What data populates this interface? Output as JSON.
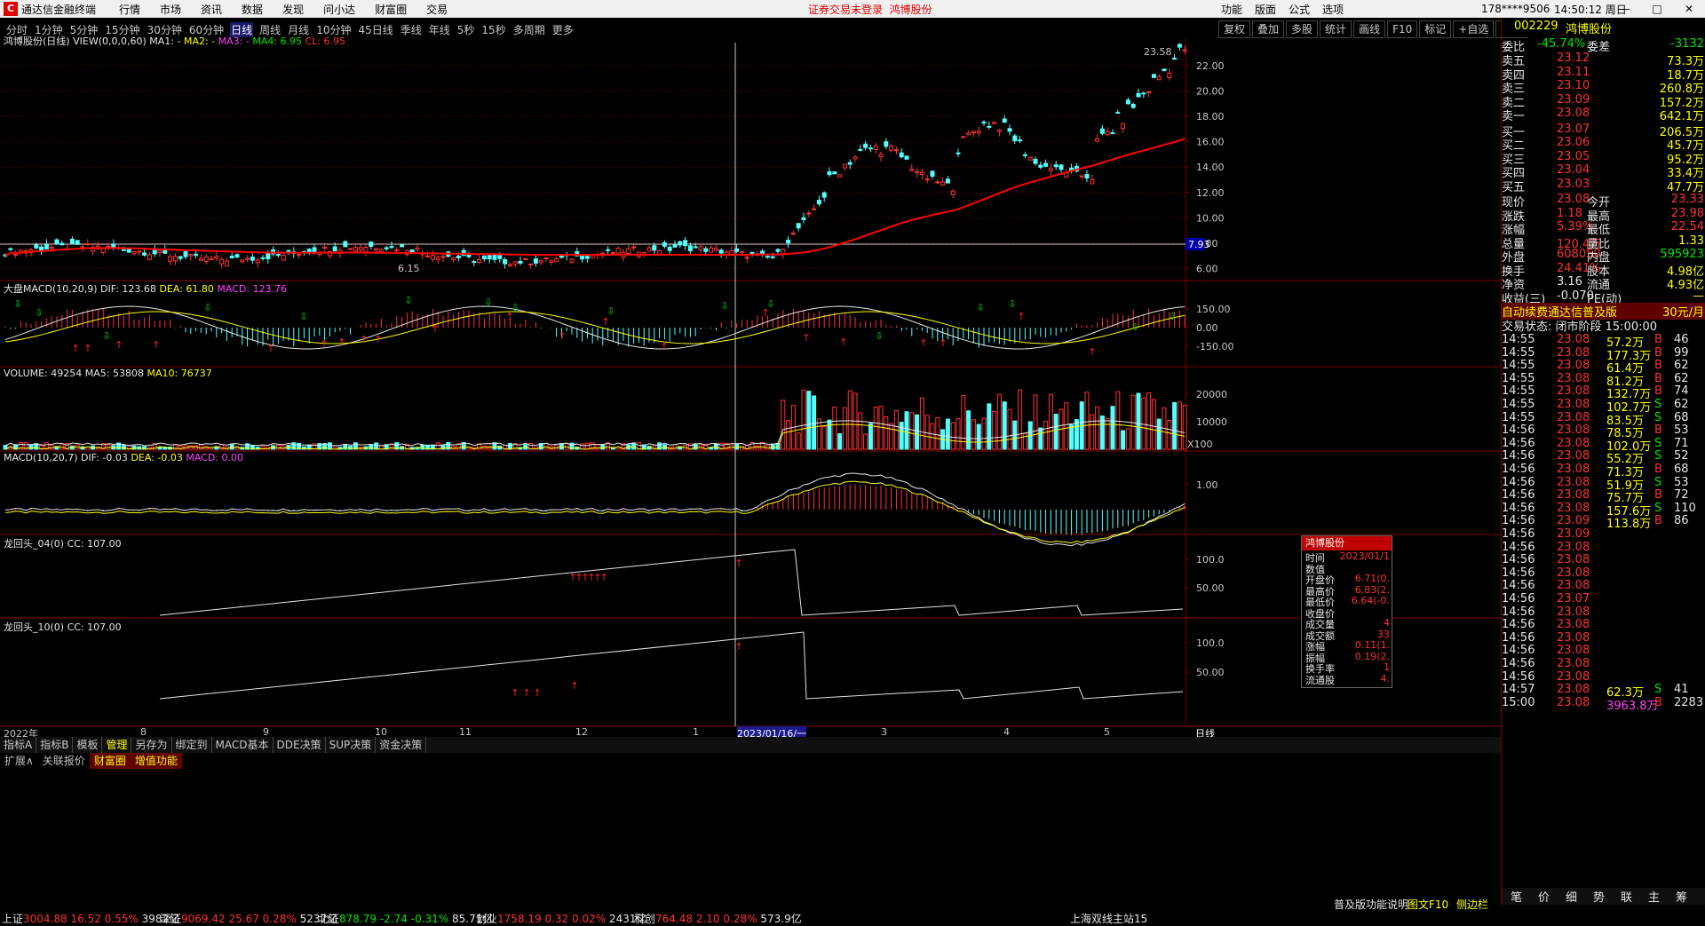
{
  "titlebar": {
    "app_name": "通达信金融终端",
    "menus": [
      "行情",
      "市场",
      "资讯",
      "数据",
      "发现",
      "问小达",
      "财富圈",
      "交易"
    ],
    "notice": "证券交易未登录",
    "stock": "鸿博股份",
    "right_menus": [
      "功能",
      "版面",
      "公式",
      "选项"
    ],
    "account": "178****9506",
    "time": "14:50:12 周日"
  },
  "periods": [
    "分时",
    "1分钟",
    "5分钟",
    "15分钟",
    "30分钟",
    "60分钟",
    "日线",
    "周线",
    "月线",
    "10分钟",
    "45日线",
    "季线",
    "年线",
    "5秒",
    "15秒",
    "多周期",
    "更多"
  ],
  "active_period": "日线",
  "toolbar_buttons": [
    "复权",
    "叠加",
    "多股",
    "统计",
    "画线",
    "F10",
    "标记",
    "+自选",
    "返回"
  ],
  "main_panel": {
    "title": "鸿博股份(日线)",
    "indicator": "VIEW(0,0,0,60)",
    "ma1": "MA1: -",
    "ma2": "MA2: -",
    "ma3": "MA3: -",
    "ma4": "MA4: 6.95",
    "cl": "CL: 6.95",
    "y_labels": [
      "22.00",
      "20.00",
      "18.00",
      "16.00",
      "14.00",
      "12.00",
      "10.00",
      "8.00",
      "6.00"
    ],
    "current_label": "7.93",
    "high_label": "23.58",
    "low_label": "6.15"
  },
  "macd1": {
    "title": "大盘MACD(10,20,9)",
    "dif": "DIF: 123.68",
    "dea": "DEA: 61.80",
    "macd": "MACD: 123.76",
    "y_labels": [
      "150.00",
      "0.00",
      "-150.00"
    ]
  },
  "volume": {
    "title": "VOLUME: 49254",
    "ma5": "MA5: 53808",
    "ma10": "MA10: 76737",
    "y_labels": [
      "20000",
      "10000"
    ],
    "unit": "X100"
  },
  "macd2": {
    "title": "MACD(10,20,7)",
    "dif": "DIF: -0.03",
    "dea": "DEA: -0.03",
    "macd": "MACD: 0.00",
    "y_labels": [
      "1.00"
    ]
  },
  "dragon1": {
    "title": "龙回头_04(0)",
    "cc": "CC: 107.00",
    "y_labels": [
      "100.0",
      "50.00"
    ]
  },
  "dragon2": {
    "title": "龙回头_10(0)",
    "cc": "CC: 107.00",
    "y_labels": [
      "100.0",
      "50.00"
    ]
  },
  "x_axis": {
    "labels": [
      "2022年",
      "8",
      "9",
      "10",
      "11",
      "12",
      "1",
      "2023/01/16/一",
      "3",
      "4",
      "5"
    ],
    "period": "日线"
  },
  "bottom_tabs": [
    "指标A",
    "指标B",
    "模板",
    "管理",
    "另存为",
    "绑定到",
    "MACD基本",
    "DDE决策",
    "SUP决策",
    "资金决策"
  ],
  "ext_bar": [
    "扩展∧",
    "关联报价",
    "财富圈",
    "增值功能"
  ],
  "quote": {
    "code": "002229",
    "name": "鸿博股份",
    "weibi_label": "委比",
    "weibi": "-45.74%",
    "weicha_label": "委差",
    "weicha": "-3132",
    "asks": [
      {
        "label": "卖五",
        "price": "23.12",
        "vol": "73.3万"
      },
      {
        "label": "卖四",
        "price": "23.11",
        "vol": "18.7万"
      },
      {
        "label": "卖三",
        "price": "23.10",
        "vol": "260.8万"
      },
      {
        "label": "卖二",
        "price": "23.09",
        "vol": "157.2万"
      },
      {
        "label": "卖一",
        "price": "23.08",
        "vol": "642.1万"
      }
    ],
    "bids": [
      {
        "label": "买一",
        "price": "23.07",
        "vol": "206.5万"
      },
      {
        "label": "买二",
        "price": "23.06",
        "vol": "45.7万"
      },
      {
        "label": "买三",
        "price": "23.05",
        "vol": "95.2万"
      },
      {
        "label": "买四",
        "price": "23.04",
        "vol": "33.4万"
      },
      {
        "label": "买五",
        "price": "23.03",
        "vol": "47.7万"
      }
    ],
    "stats": [
      {
        "l1": "现价",
        "v1": "23.08",
        "l2": "今开",
        "v2": "23.33"
      },
      {
        "l1": "涨跌",
        "v1": "1.18",
        "l2": "最高",
        "v2": "23.98"
      },
      {
        "l1": "涨幅",
        "v1": "5.39%",
        "l2": "最低",
        "v2": "22.54"
      },
      {
        "l1": "总量",
        "v1": "120.4万",
        "l2": "量比",
        "v2": "1.33"
      },
      {
        "l1": "外盘",
        "v1": "608050",
        "l2": "内盘",
        "v2": "595923"
      },
      {
        "l1": "换手",
        "v1": "24.41%",
        "l2": "股本",
        "v2": "4.98亿"
      },
      {
        "l1": "净资",
        "v1": "3.16",
        "l2": "流通",
        "v2": "4.93亿"
      },
      {
        "l1": "收益(三)",
        "v1": "-0.070",
        "l2": "PE(动)",
        "v2": "—"
      }
    ],
    "ad_text": "自动续费通达信普及版",
    "ad_price": "30元/月",
    "trade_status": "交易状态: 闭市阶段 15:00:00",
    "ticks": [
      {
        "t": "14:55",
        "p": "23.08",
        "v": "57.2万",
        "d": "B",
        "n": "46"
      },
      {
        "t": "14:55",
        "p": "23.08",
        "v": "177.3万",
        "d": "B",
        "n": "99"
      },
      {
        "t": "14:55",
        "p": "23.08",
        "v": "61.4万",
        "d": "B",
        "n": "62"
      },
      {
        "t": "14:55",
        "p": "23.08",
        "v": "81.2万",
        "d": "B",
        "n": "62"
      },
      {
        "t": "14:55",
        "p": "23.08",
        "v": "132.7万",
        "d": "B",
        "n": "74"
      },
      {
        "t": "14:55",
        "p": "23.08",
        "v": "102.7万",
        "d": "S",
        "n": "62"
      },
      {
        "t": "14:55",
        "p": "23.08",
        "v": "83.5万",
        "d": "S",
        "n": "68"
      },
      {
        "t": "14:56",
        "p": "23.08",
        "v": "78.5万",
        "d": "B",
        "n": "53"
      },
      {
        "t": "14:56",
        "p": "23.08",
        "v": "102.0万",
        "d": "S",
        "n": "71"
      },
      {
        "t": "14:56",
        "p": "23.08",
        "v": "55.2万",
        "d": "S",
        "n": "52"
      },
      {
        "t": "14:56",
        "p": "23.08",
        "v": "71.3万",
        "d": "B",
        "n": "68"
      },
      {
        "t": "14:56",
        "p": "23.08",
        "v": "51.9万",
        "d": "S",
        "n": "53"
      },
      {
        "t": "14:56",
        "p": "23.08",
        "v": "75.7万",
        "d": "B",
        "n": "72"
      },
      {
        "t": "14:56",
        "p": "23.08",
        "v": "157.6万",
        "d": "S",
        "n": "110"
      },
      {
        "t": "14:56",
        "p": "23.09",
        "v": "113.8万",
        "d": "B",
        "n": "86"
      },
      {
        "t": "14:56",
        "p": "23.09",
        "v": "",
        "d": "",
        "n": ""
      },
      {
        "t": "14:56",
        "p": "23.08",
        "v": "",
        "d": "",
        "n": ""
      },
      {
        "t": "14:56",
        "p": "23.08",
        "v": "",
        "d": "",
        "n": ""
      },
      {
        "t": "14:56",
        "p": "23.08",
        "v": "",
        "d": "",
        "n": ""
      },
      {
        "t": "14:56",
        "p": "23.08",
        "v": "",
        "d": "",
        "n": ""
      },
      {
        "t": "14:56",
        "p": "23.07",
        "v": "",
        "d": "",
        "n": ""
      },
      {
        "t": "14:56",
        "p": "23.08",
        "v": "",
        "d": "",
        "n": ""
      },
      {
        "t": "14:56",
        "p": "23.08",
        "v": "",
        "d": "",
        "n": ""
      },
      {
        "t": "14:56",
        "p": "23.08",
        "v": "",
        "d": "",
        "n": ""
      },
      {
        "t": "14:56",
        "p": "23.08",
        "v": "",
        "d": "",
        "n": ""
      },
      {
        "t": "14:56",
        "p": "23.08",
        "v": "",
        "d": "",
        "n": ""
      },
      {
        "t": "14:56",
        "p": "23.08",
        "v": "",
        "d": "",
        "n": ""
      },
      {
        "t": "14:57",
        "p": "23.08",
        "v": "62.3万",
        "d": "S",
        "n": "41"
      },
      {
        "t": "15:00",
        "p": "23.08",
        "v": "3963.8万",
        "d": "B",
        "n": "2283"
      }
    ],
    "bottom_tabs": [
      "笔",
      "价",
      "细",
      "势",
      "联",
      "主",
      "筹"
    ]
  },
  "popup": {
    "title": "鸿博股份",
    "rows": [
      {
        "k": "时间",
        "v": "2023/01/1"
      },
      {
        "k": "数值",
        "v": ""
      },
      {
        "k": "开盘价",
        "v": "6.71(0."
      },
      {
        "k": "最高价",
        "v": "6.83(2."
      },
      {
        "k": "最低价",
        "v": "6.64(-0."
      },
      {
        "k": "收盘价",
        "v": ""
      },
      {
        "k": "成交量",
        "v": "4"
      },
      {
        "k": "成交额",
        "v": "33"
      },
      {
        "k": "涨幅",
        "v": "0.11(1."
      },
      {
        "k": "振幅",
        "v": "0.19(2."
      },
      {
        "k": "换手率",
        "v": "1"
      },
      {
        "k": "流通股",
        "v": "4."
      }
    ]
  },
  "statusbar": {
    "items": [
      {
        "name": "上证",
        "val": "3004.88",
        "chg": "16.52",
        "pct": "0.55%",
        "amt": "3982亿"
      },
      {
        "name": "深证",
        "val": "9069.42",
        "chg": "25.67",
        "pct": "0.28%",
        "amt": "5237亿"
      },
      {
        "name": "北证",
        "val": "878.79",
        "chg": "-2.74",
        "pct": "-0.31%",
        "amt": "85.71亿"
      },
      {
        "name": "创业",
        "val": "1758.19",
        "chg": "0.32",
        "pct": "0.02%",
        "amt": "2431亿"
      },
      {
        "name": "科创",
        "val": "764.48",
        "chg": "2.10",
        "pct": "0.28%",
        "amt": "573.9亿"
      }
    ],
    "server": "上海双线主站15",
    "help": "普及版功能说明",
    "f10": "图文F10",
    "sidebar": "侧边栏"
  },
  "colors": {
    "up": "#ff3232",
    "down": "#54ffff",
    "ma": "#ff0000",
    "panel_border": "#800000"
  }
}
